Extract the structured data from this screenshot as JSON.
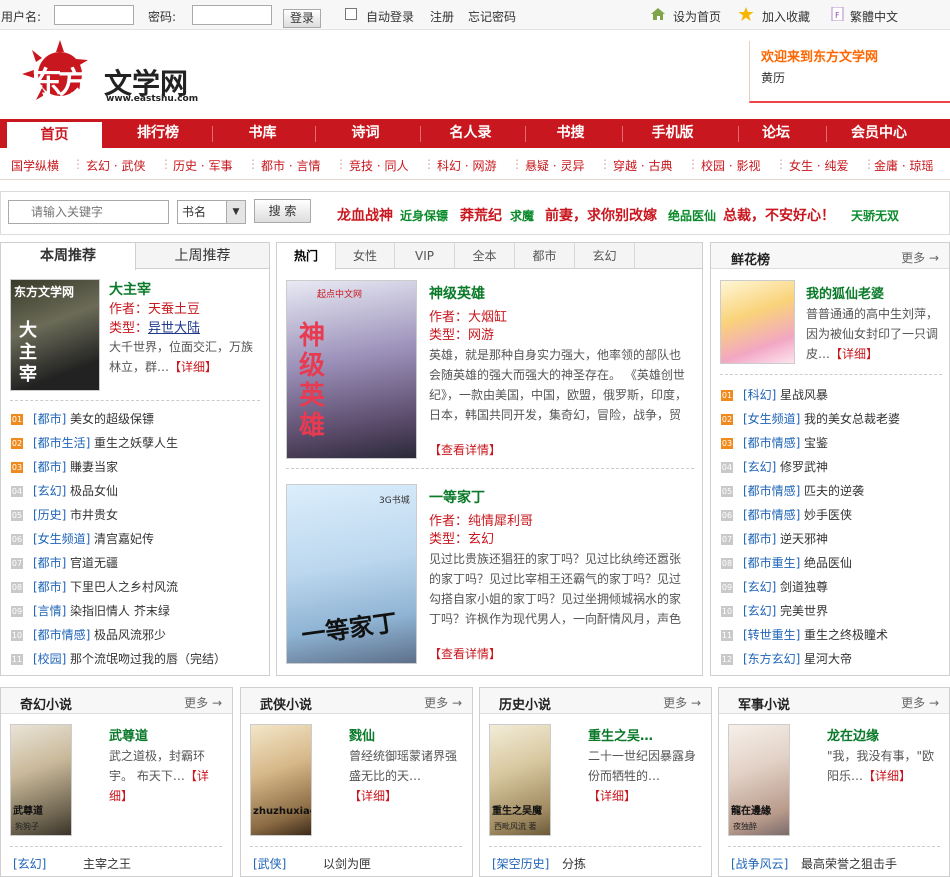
{
  "topbar": {
    "username_label": "用户名:",
    "password_label": "密码:",
    "login_label": "登录",
    "auto_login_label": "自动登录",
    "register_label": "注册",
    "forgot_label": "忘记密码",
    "set_home_label": "设为首页",
    "favorite_label": "加入收藏",
    "traditional_label": "繁體中文"
  },
  "logo": {
    "text_big": "东方",
    "text_right": "文学网",
    "url": "www.eastshu.com"
  },
  "welcome": {
    "line1": "欢迎来到东方文学网",
    "line2": "黄历"
  },
  "nav": [
    "首页",
    "排行榜",
    "书库",
    "诗词",
    "名人录",
    "书搜",
    "手机版",
    "论坛",
    "会员中心"
  ],
  "subnav": [
    "国学纵横",
    "玄幻 · 武侠",
    "历史 · 军事",
    "都市 · 言情",
    "竞技 · 同人",
    "科幻 · 网游",
    "悬疑 · 灵异",
    "穿越 · 古典",
    "校园 · 影视",
    "女生 · 纯爱",
    "金庸 · 琼瑶"
  ],
  "search": {
    "placeholder": "请输入关键字",
    "select_value": "书名",
    "button_label": "搜 索",
    "hot": [
      {
        "text": "龙血战神",
        "color": "#c8171e",
        "size": 14
      },
      {
        "text": "近身保镖",
        "color": "#0a8a2a",
        "size": 12
      },
      {
        "text": "莽荒纪",
        "color": "#c8171e",
        "size": 14
      },
      {
        "text": "求魔",
        "color": "#0a8a2a",
        "size": 12
      },
      {
        "text": "前妻，求你别改嫁",
        "color": "#c8171e",
        "size": 14
      },
      {
        "text": "绝品医仙",
        "color": "#0a8a2a",
        "size": 12
      },
      {
        "text": "总裁，不安好心！",
        "color": "#c8171e",
        "size": 14
      },
      {
        "text": "天骄无双",
        "color": "#0a8a2a",
        "size": 12
      }
    ]
  },
  "weekly": {
    "tab_this": "本周推荐",
    "tab_last": "上周推荐",
    "featured": {
      "title": "大主宰",
      "author_label": "作者：",
      "author": "天蚕土豆",
      "type_label": "类型：",
      "type": "异世大陆",
      "desc": "大千世界，位面交汇，万族林立，群…",
      "more": "【详细】",
      "cover_top": "东方文学网",
      "cover_title": "大主宰"
    },
    "items": [
      {
        "num": "01",
        "cat": "[都市]",
        "title": "美女的超级保镖"
      },
      {
        "num": "02",
        "cat": "[都市生活]",
        "title": "重生之妖孽人生"
      },
      {
        "num": "03",
        "cat": "[都市]",
        "title": "賺妻当家"
      },
      {
        "num": "04",
        "cat": "[玄幻]",
        "title": "极品女仙"
      },
      {
        "num": "05",
        "cat": "[历史]",
        "title": "市井贵女"
      },
      {
        "num": "06",
        "cat": "[女生频道]",
        "title": "清宫嘉妃传"
      },
      {
        "num": "07",
        "cat": "[都市]",
        "title": "官道无疆"
      },
      {
        "num": "08",
        "cat": "[都市]",
        "title": "下里巴人之乡村风流"
      },
      {
        "num": "09",
        "cat": "[言情]",
        "title": "染指旧情人  芥末绿"
      },
      {
        "num": "10",
        "cat": "[都市情感]",
        "title": "极品风流邪少"
      },
      {
        "num": "11",
        "cat": "[校园]",
        "title": "那个流氓吻过我的唇（完结）"
      }
    ]
  },
  "center": {
    "tabs": [
      "热门",
      "女性",
      "VIP",
      "全本",
      "都市",
      "玄幻"
    ],
    "books": [
      {
        "title": "神级英雄",
        "author_label": "作者：",
        "author": "大烟缸",
        "type_label": "类型：",
        "type": "网游",
        "desc": "英雄，就是那种自身实力强大，他率领的部队也会随英雄的强大而强大的神圣存在。 《英雄创世纪》，一款由美国，中国，欧盟，俄罗斯，印度，日本，韩国共同开发，集奇幻，冒险，战争，贸易，领地建设，航海，竞技…",
        "more": "【查看详情】",
        "cover_title": "神级英雄",
        "cover_brand": "起点中文网"
      },
      {
        "title": "一等家丁",
        "author_label": "作者：",
        "author": "纯情犀利哥",
        "type_label": "类型：",
        "type": "玄幻",
        "desc": "见过比贵族还猖狂的家丁吗？见过比纨绔还嚣张的家丁吗？见过比宰相王还霸气的家丁吗？见过勾搭自家小姐的家丁吗？见过坐拥倾城祸水的家丁吗？许枫作为现代男人，一向酐情风月，声色犬马。却因为意外重生异界，混迹…",
        "more": "【查看详情】",
        "cover_title": "一等家丁",
        "cover_brand": "3G书城"
      }
    ]
  },
  "flowers": {
    "title": "鲜花榜",
    "more": "更多 →",
    "featured": {
      "title": "我的狐仙老婆",
      "desc": "普普通通的高中生刘萍，因为被仙女封印了一只调皮…",
      "more": "【详细】"
    },
    "items": [
      {
        "num": "01",
        "cat": "[科幻]",
        "title": "星战风暴"
      },
      {
        "num": "02",
        "cat": "[女生频道]",
        "title": "我的美女总裁老婆"
      },
      {
        "num": "03",
        "cat": "[都市情感]",
        "title": "宝鉴"
      },
      {
        "num": "04",
        "cat": "[玄幻]",
        "title": "修罗武神"
      },
      {
        "num": "05",
        "cat": "[都市情感]",
        "title": "匹夫的逆袭"
      },
      {
        "num": "06",
        "cat": "[都市情感]",
        "title": "妙手医侠"
      },
      {
        "num": "07",
        "cat": "[都市]",
        "title": "逆天邪神"
      },
      {
        "num": "08",
        "cat": "[都市重生]",
        "title": "绝品医仙"
      },
      {
        "num": "09",
        "cat": "[玄幻]",
        "title": "剑道独尊"
      },
      {
        "num": "10",
        "cat": "[玄幻]",
        "title": "完美世界"
      },
      {
        "num": "11",
        "cat": "[转世重生]",
        "title": "重生之终极瞳术"
      },
      {
        "num": "12",
        "cat": "[东方玄幻]",
        "title": "星河大帝"
      }
    ]
  },
  "sections": [
    {
      "title": "奇幻小说",
      "more": "更多 →",
      "book": "武尊道",
      "desc": "武之道极，封霸环宇。 布天下…",
      "detail": "【详细】",
      "cover_title": "武尊道",
      "cover_author": "狗狗子",
      "next_cat": "[玄幻]",
      "next_title": "主宰之王"
    },
    {
      "title": "武侠小说",
      "more": "更多 →",
      "book": "戮仙",
      "desc": "曾经统御瑶蒙诸界强盛无比的天…",
      "detail": "【详细】",
      "cover_title": "zhuzhuxiao.com",
      "cover_author": "",
      "next_cat": "[武侠]",
      "next_title": "以剑为匣"
    },
    {
      "title": "历史小说",
      "more": "更多 →",
      "book": "重生之吴…",
      "desc": "二十一世纪因暴露身份而牺牲的…",
      "detail": "【详细】",
      "cover_title": "重生之吴魔",
      "cover_author": "西毗风流 著",
      "next_cat": "[架空历史]",
      "next_title": "分拣"
    },
    {
      "title": "军事小说",
      "more": "更多 →",
      "book": "龙在边缘",
      "desc": "\"我，我没有事，\"欧阳乐…",
      "detail": "【详细】",
      "cover_title": "龍在邊緣",
      "cover_author": "夜独醉",
      "next_cat": "[战争风云]",
      "next_title": "最高荣誉之狙击手"
    }
  ]
}
